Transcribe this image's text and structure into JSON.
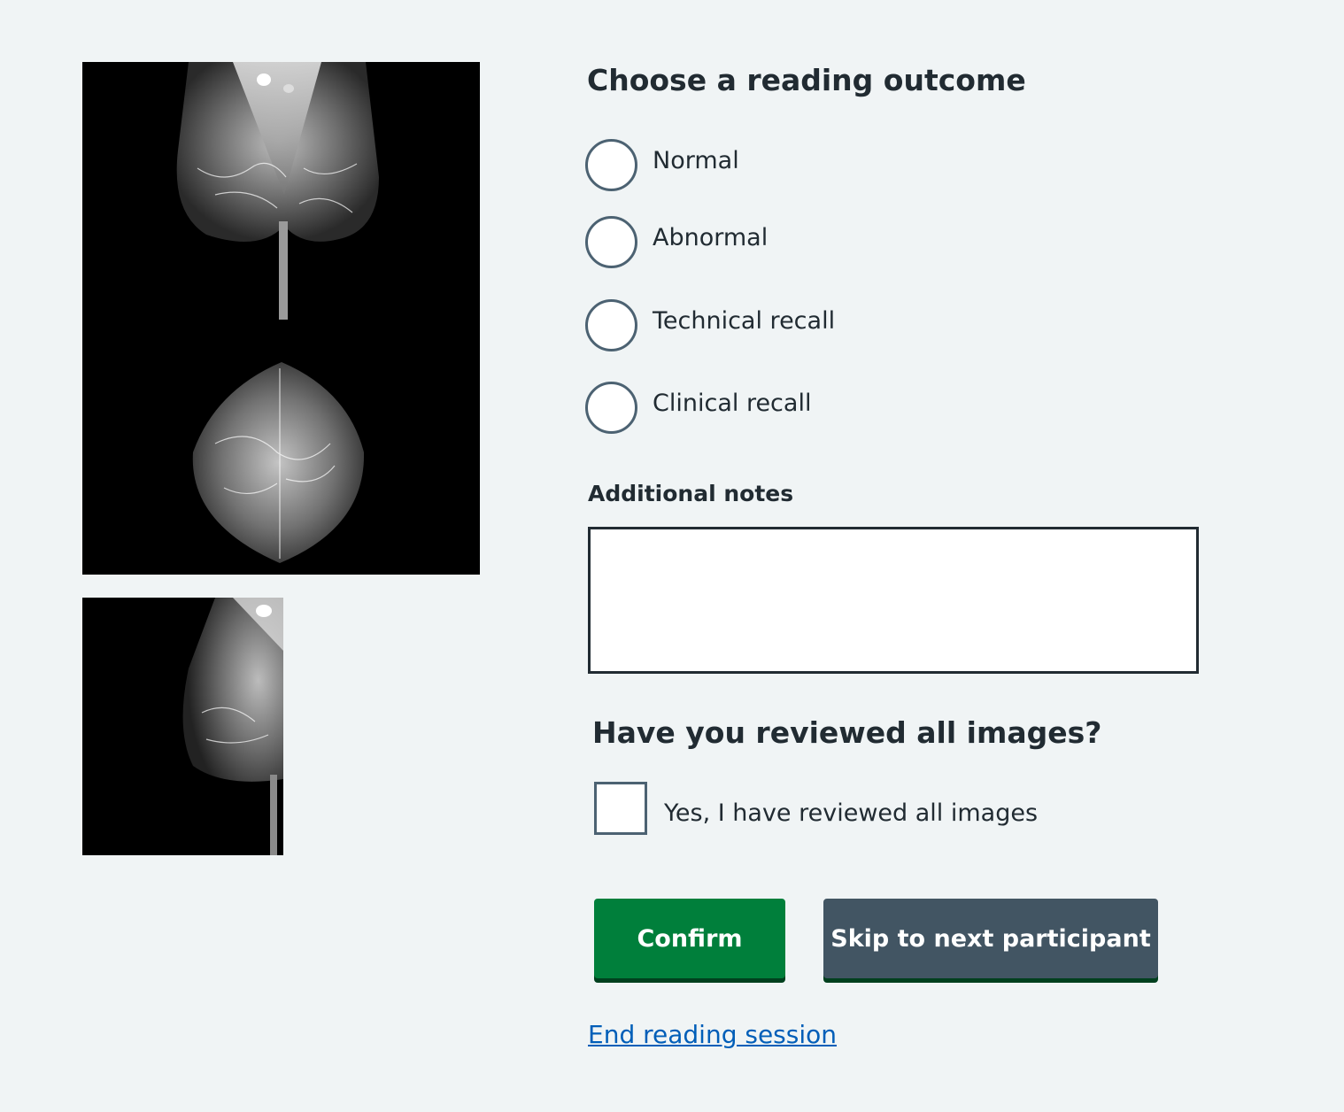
{
  "images": [
    {
      "name": "mlo-view-image"
    },
    {
      "name": "cc-view-image"
    },
    {
      "name": "partial-view-image"
    }
  ],
  "outcome": {
    "heading": "Choose a reading outcome",
    "options": [
      {
        "label": "Normal",
        "selected": false
      },
      {
        "label": "Abnormal",
        "selected": false
      },
      {
        "label": "Technical recall",
        "selected": false
      },
      {
        "label": "Clinical recall",
        "selected": false
      }
    ]
  },
  "notes": {
    "label": "Additional notes",
    "value": ""
  },
  "review": {
    "heading": "Have you reviewed all images?",
    "checkbox_label": "Yes, I have reviewed all images",
    "checked": false
  },
  "actions": {
    "confirm_label": "Confirm",
    "skip_label": "Skip to next participant",
    "end_link_label": "End reading session"
  },
  "colors": {
    "background": "#f0f4f5",
    "text": "#212b32",
    "confirm": "#007f3b",
    "skip": "#425563",
    "link": "#005eb8",
    "control_border": "#4c6272"
  },
  "icons": [
    "radio-icon",
    "checkbox-icon"
  ]
}
